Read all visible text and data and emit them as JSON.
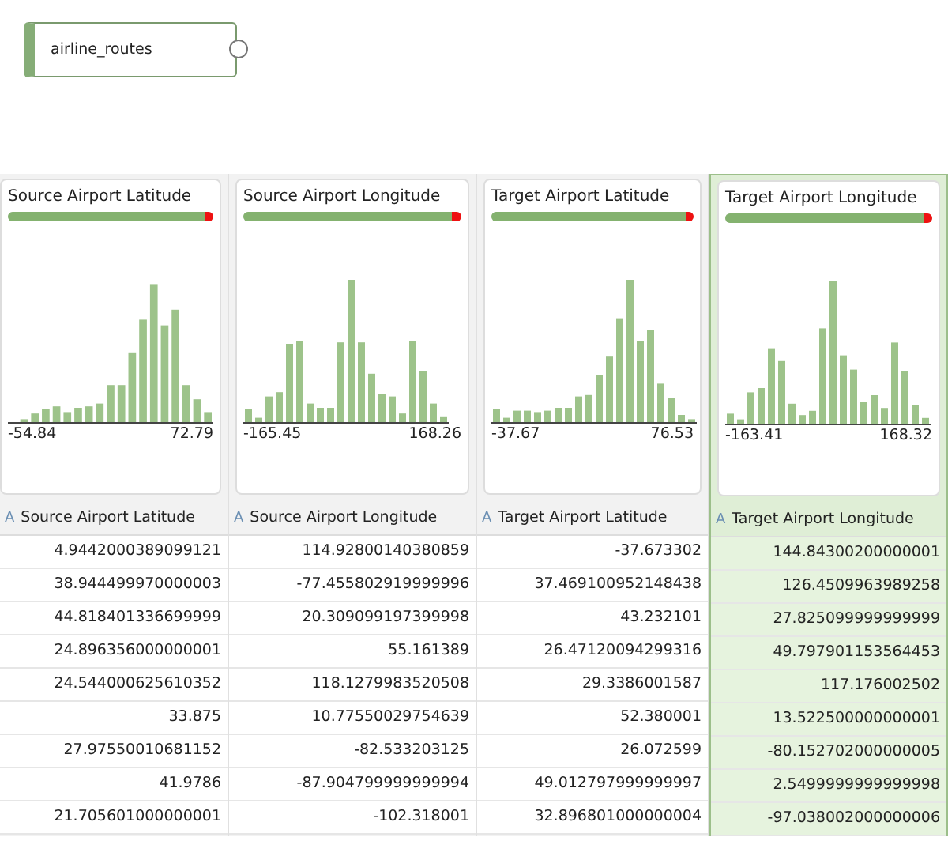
{
  "node": {
    "label": "airline_routes"
  },
  "columns": [
    {
      "name": "Source Airport Latitude",
      "selected": false,
      "level": 0.96,
      "min": "-54.84",
      "max": "72.79",
      "header": "Source Airport Latitude",
      "type_icon": "A",
      "cells": [
        "4.9442000389099121",
        "38.944499970000003",
        "44.818401336699999",
        "24.896356000000001",
        "24.544000625610352",
        "33.875",
        "27.97550010681152",
        "41.9786",
        "21.705601000000001"
      ]
    },
    {
      "name": "Source Airport Longitude",
      "selected": false,
      "level": 0.96,
      "min": "-165.45",
      "max": "168.26",
      "header": "Source Airport Longitude",
      "type_icon": "A",
      "cells": [
        "114.92800140380859",
        "-77.455802919999996",
        "20.309099197399998",
        "55.161389",
        "118.1279983520508",
        "10.77550029754639",
        "-82.533203125",
        "-87.904799999999994",
        "-102.318001"
      ]
    },
    {
      "name": "Target Airport Latitude",
      "selected": false,
      "level": 0.96,
      "min": "-37.67",
      "max": "76.53",
      "header": "Target Airport Latitude",
      "type_icon": "A",
      "cells": [
        "-37.673302",
        "37.469100952148438",
        "43.232101",
        "26.47120094299316",
        "29.3386001587",
        "52.380001",
        "26.072599",
        "49.012797999999997",
        "32.896801000000004"
      ]
    },
    {
      "name": "Target Airport Longitude",
      "selected": true,
      "level": 0.96,
      "min": "-163.41",
      "max": "168.32",
      "header": "Target Airport Longitude",
      "type_icon": "A",
      "cells": [
        "144.84300200000001",
        "126.4509963989258",
        "27.825099999999999",
        "49.797901153564453",
        "117.176002502",
        "13.522500000000001",
        "-80.152702000000005",
        "2.5499999999999998",
        "-97.038002000000006"
      ]
    }
  ]
}
